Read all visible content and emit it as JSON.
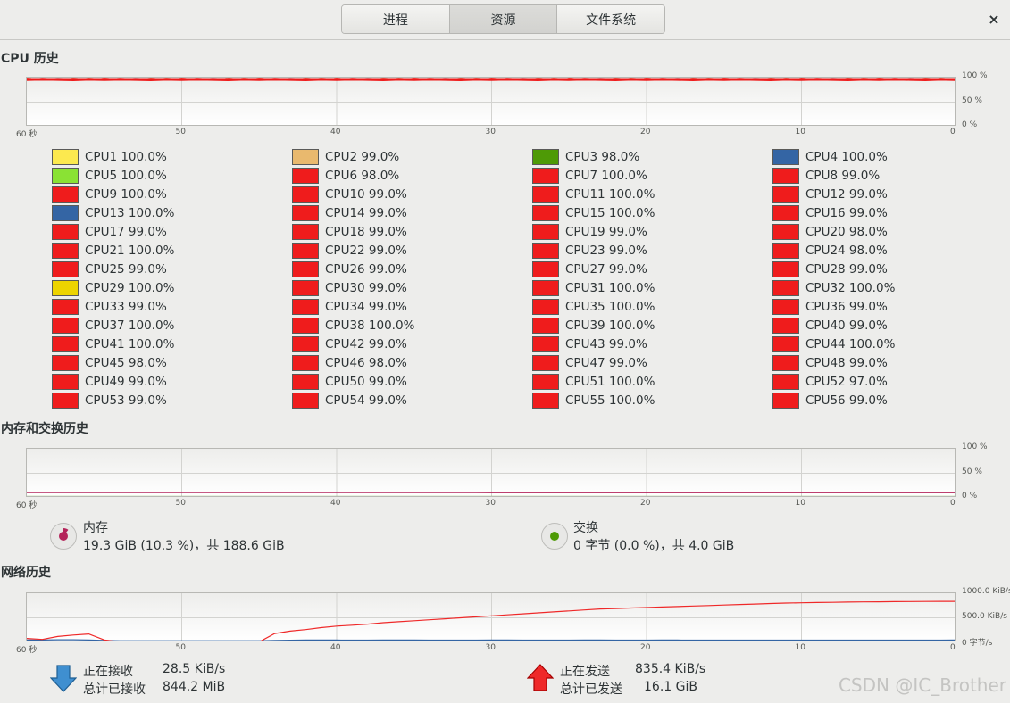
{
  "tabs": [
    {
      "label": "进程"
    },
    {
      "label": "资源"
    },
    {
      "label": "文件系统"
    }
  ],
  "close_label": "×",
  "cpu": {
    "title": "CPU 历史",
    "x_ticks": [
      "60 秒",
      "50",
      "40",
      "30",
      "20",
      "10",
      "0"
    ],
    "y_ticks": [
      "100 %",
      "50 %",
      "0 %"
    ],
    "cores": [
      {
        "label": "CPU1 100.0%",
        "color": "#fce94f"
      },
      {
        "label": "CPU2 99.0%",
        "color": "#e9b96e"
      },
      {
        "label": "CPU3 98.0%",
        "color": "#4e9a06"
      },
      {
        "label": "CPU4 100.0%",
        "color": "#3465a4"
      },
      {
        "label": "CPU5 100.0%",
        "color": "#8ae234"
      },
      {
        "label": "CPU6 98.0%",
        "color": "#ef1c1c"
      },
      {
        "label": "CPU7 100.0%",
        "color": "#ef1c1c"
      },
      {
        "label": "CPU8 99.0%",
        "color": "#ef1c1c"
      },
      {
        "label": "CPU9 100.0%",
        "color": "#ef1c1c"
      },
      {
        "label": "CPU10 99.0%",
        "color": "#ef1c1c"
      },
      {
        "label": "CPU11 100.0%",
        "color": "#ef1c1c"
      },
      {
        "label": "CPU12 99.0%",
        "color": "#ef1c1c"
      },
      {
        "label": "CPU13 100.0%",
        "color": "#3465a4"
      },
      {
        "label": "CPU14 99.0%",
        "color": "#ef1c1c"
      },
      {
        "label": "CPU15 100.0%",
        "color": "#ef1c1c"
      },
      {
        "label": "CPU16 99.0%",
        "color": "#ef1c1c"
      },
      {
        "label": "CPU17 99.0%",
        "color": "#ef1c1c"
      },
      {
        "label": "CPU18 99.0%",
        "color": "#ef1c1c"
      },
      {
        "label": "CPU19 99.0%",
        "color": "#ef1c1c"
      },
      {
        "label": "CPU20 98.0%",
        "color": "#ef1c1c"
      },
      {
        "label": "CPU21 100.0%",
        "color": "#ef1c1c"
      },
      {
        "label": "CPU22 99.0%",
        "color": "#ef1c1c"
      },
      {
        "label": "CPU23 99.0%",
        "color": "#ef1c1c"
      },
      {
        "label": "CPU24 98.0%",
        "color": "#ef1c1c"
      },
      {
        "label": "CPU25 99.0%",
        "color": "#ef1c1c"
      },
      {
        "label": "CPU26 99.0%",
        "color": "#ef1c1c"
      },
      {
        "label": "CPU27 99.0%",
        "color": "#ef1c1c"
      },
      {
        "label": "CPU28 99.0%",
        "color": "#ef1c1c"
      },
      {
        "label": "CPU29 100.0%",
        "color": "#edd400"
      },
      {
        "label": "CPU30 99.0%",
        "color": "#ef1c1c"
      },
      {
        "label": "CPU31 100.0%",
        "color": "#ef1c1c"
      },
      {
        "label": "CPU32 100.0%",
        "color": "#ef1c1c"
      },
      {
        "label": "CPU33 99.0%",
        "color": "#ef1c1c"
      },
      {
        "label": "CPU34 99.0%",
        "color": "#ef1c1c"
      },
      {
        "label": "CPU35 100.0%",
        "color": "#ef1c1c"
      },
      {
        "label": "CPU36 99.0%",
        "color": "#ef1c1c"
      },
      {
        "label": "CPU37 100.0%",
        "color": "#ef1c1c"
      },
      {
        "label": "CPU38 100.0%",
        "color": "#ef1c1c"
      },
      {
        "label": "CPU39 100.0%",
        "color": "#ef1c1c"
      },
      {
        "label": "CPU40 99.0%",
        "color": "#ef1c1c"
      },
      {
        "label": "CPU41 100.0%",
        "color": "#ef1c1c"
      },
      {
        "label": "CPU42 99.0%",
        "color": "#ef1c1c"
      },
      {
        "label": "CPU43 99.0%",
        "color": "#ef1c1c"
      },
      {
        "label": "CPU44 100.0%",
        "color": "#ef1c1c"
      },
      {
        "label": "CPU45 98.0%",
        "color": "#ef1c1c"
      },
      {
        "label": "CPU46 98.0%",
        "color": "#ef1c1c"
      },
      {
        "label": "CPU47 99.0%",
        "color": "#ef1c1c"
      },
      {
        "label": "CPU48 99.0%",
        "color": "#ef1c1c"
      },
      {
        "label": "CPU49 99.0%",
        "color": "#ef1c1c"
      },
      {
        "label": "CPU50 99.0%",
        "color": "#ef1c1c"
      },
      {
        "label": "CPU51 100.0%",
        "color": "#ef1c1c"
      },
      {
        "label": "CPU52 97.0%",
        "color": "#ef1c1c"
      },
      {
        "label": "CPU53 99.0%",
        "color": "#ef1c1c"
      },
      {
        "label": "CPU54 99.0%",
        "color": "#ef1c1c"
      },
      {
        "label": "CPU55 100.0%",
        "color": "#ef1c1c"
      },
      {
        "label": "CPU56 99.0%",
        "color": "#ef1c1c"
      }
    ]
  },
  "memory": {
    "title": "内存和交换历史",
    "x_ticks": [
      "60 秒",
      "50",
      "40",
      "30",
      "20",
      "10",
      "0"
    ],
    "y_ticks": [
      "100 %",
      "50 %",
      "0 %"
    ],
    "mem_label": "内存",
    "mem_value": "19.3 GiB (10.3 %)，共 188.6 GiB",
    "mem_color": "#b4245a",
    "mem_fraction": 0.103,
    "swap_label": "交换",
    "swap_value": "0 字节 (0.0 %)，共 4.0 GiB",
    "swap_color": "#4e9a06"
  },
  "network": {
    "title": "网络历史",
    "x_ticks": [
      "60 秒",
      "50",
      "40",
      "30",
      "20",
      "10",
      "0"
    ],
    "y_ticks": [
      "1000.0 KiB/s",
      "500.0 KiB/s",
      "0 字节/s"
    ],
    "recv_label": "正在接收",
    "recv_value": "28.5 KiB/s",
    "recv_total_label": "总计已接收",
    "recv_total_value": "844.2 MiB",
    "send_label": "正在发送",
    "send_value": "835.4 KiB/s",
    "send_total_label": "总计已发送",
    "send_total_value": "16.1 GiB",
    "recv_color": "#3465a4",
    "send_color": "#ef2929"
  },
  "watermark": "CSDN @IC_Brother"
}
